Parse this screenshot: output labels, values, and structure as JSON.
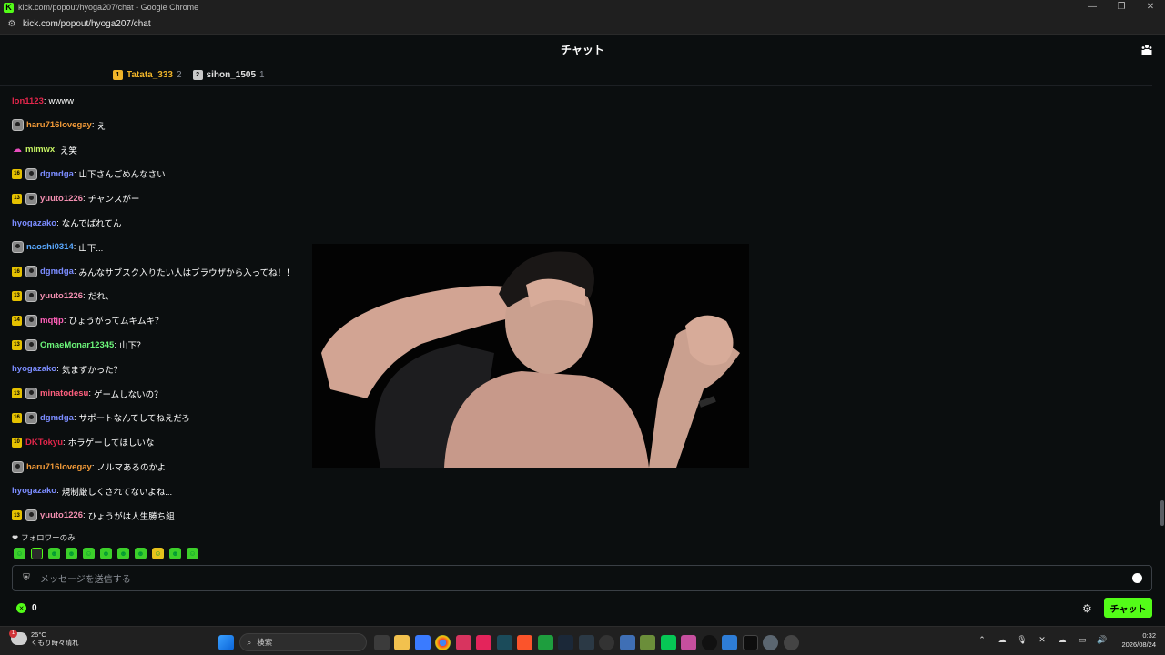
{
  "window": {
    "title": "kick.com/popout/hyoga207/chat - Google Chrome",
    "minimize_glyph": "—",
    "restore_glyph": "❐",
    "close_glyph": "✕"
  },
  "address": {
    "url": "kick.com/popout/hyoga207/chat"
  },
  "header": {
    "title": "チャット"
  },
  "leaderboard": [
    {
      "rank": "1",
      "name": "Tatata_333",
      "count": "2",
      "color": "#f0b429",
      "badge_color": "#f0b429"
    },
    {
      "rank": "2",
      "name": "sihon_1505",
      "count": "1",
      "color": "#e0e0e0",
      "badge_color": "#c9c9c9"
    }
  ],
  "messages": [
    {
      "badges": [],
      "user": "lon1123",
      "color": "#e3264b",
      "text": "wwww"
    },
    {
      "badges": [
        "og"
      ],
      "user": "haru716lovegay",
      "color": "#f29a38",
      "text": "え"
    },
    {
      "badges": [
        "pink"
      ],
      "user": "mimwx",
      "color": "#c7f464",
      "text": "え笑"
    },
    {
      "badges": [
        "16",
        "og"
      ],
      "user": "dgmdga",
      "color": "#7b8cff",
      "text": "山下さんごめんなさい"
    },
    {
      "badges": [
        "13",
        "og"
      ],
      "user": "yuuto1226",
      "color": "#f48fb1",
      "text": "チャンスがー"
    },
    {
      "badges": [],
      "user": "hyogazako",
      "color": "#7b8cff",
      "text": "なんでばれてん"
    },
    {
      "badges": [
        "og"
      ],
      "user": "naoshi0314",
      "color": "#5aa9ff",
      "text": "山下..."
    },
    {
      "badges": [
        "16",
        "og"
      ],
      "user": "dgmdga",
      "color": "#7b8cff",
      "text": "みんなサブスク入りたい人はブラウザから入ってね！！"
    },
    {
      "badges": [
        "13",
        "og"
      ],
      "user": "yuuto1226",
      "color": "#f48fb1",
      "text": "だれ、"
    },
    {
      "badges": [
        "14",
        "og"
      ],
      "user": "mqtjp",
      "color": "#ff5fb8",
      "text": "ひょうがってムキムキ？"
    },
    {
      "badges": [
        "13",
        "og"
      ],
      "user": "OmaeMonar12345",
      "color": "#6cf57a",
      "text": "山下？"
    },
    {
      "badges": [],
      "user": "hyogazako",
      "color": "#7b8cff",
      "text": "気まずかった？"
    },
    {
      "badges": [
        "13",
        "og"
      ],
      "user": "minatodesu",
      "color": "#ff5f7e",
      "text": "ゲームしないの？"
    },
    {
      "badges": [
        "16",
        "og"
      ],
      "user": "dgmdga",
      "color": "#7b8cff",
      "text": "サポートなんてしてねえだろ"
    },
    {
      "badges": [
        "10"
      ],
      "user": "DKTokyu",
      "color": "#e3264b",
      "text": "ホラゲーしてほしいな"
    },
    {
      "badges": [
        "og"
      ],
      "user": "haru716lovegay",
      "color": "#f29a38",
      "text": "ノルマあるのかよ"
    },
    {
      "badges": [],
      "user": "hyogazako",
      "color": "#7b8cff",
      "text": "規制厳しくされてないよね..."
    },
    {
      "badges": [
        "13",
        "og"
      ],
      "user": "yuuto1226",
      "color": "#f48fb1",
      "text": "ひょうがは人生勝ち組"
    }
  ],
  "followers_only": "フォロワーのみ",
  "input": {
    "placeholder": "メッセージを送信する"
  },
  "points": "0",
  "send_label": "チャット",
  "taskbar": {
    "weather_temp": "25°C",
    "weather_desc": "くもり時々晴れ",
    "weather_badge": "1",
    "search_placeholder": "検索",
    "time": "0:32",
    "date": "2026/08/24"
  },
  "colors": {
    "accent": "#53fc18",
    "background": "#0b0e0f"
  }
}
